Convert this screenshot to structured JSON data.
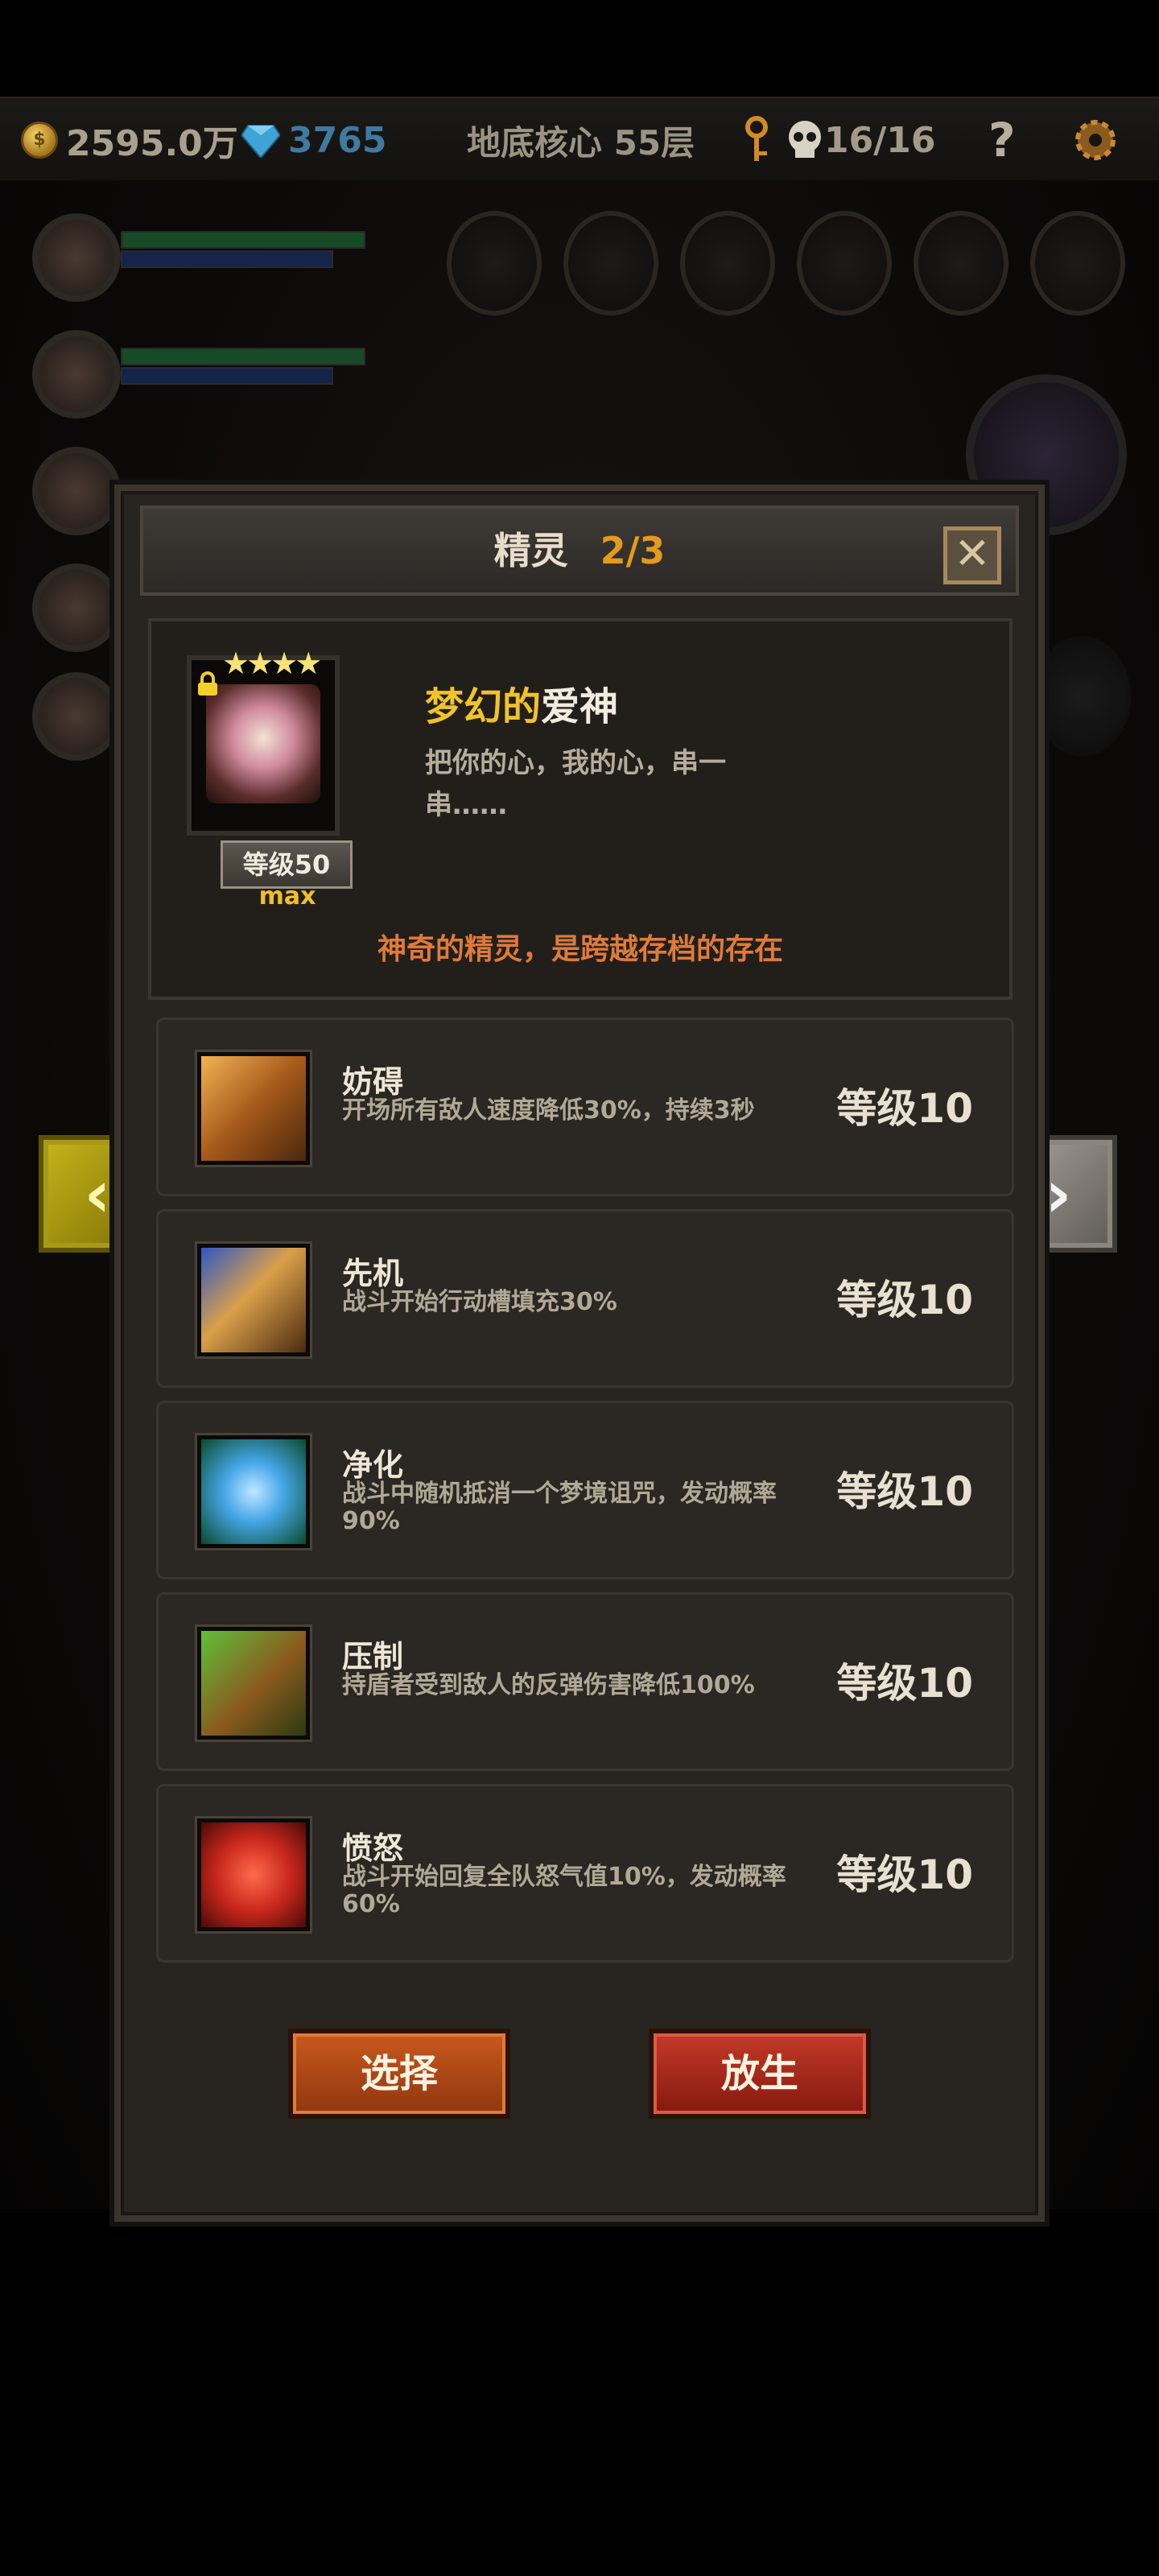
{
  "hud": {
    "gold": "2595.0万",
    "gems": "3765",
    "floor": "地底核心 55层",
    "skull_count": "16/16",
    "help": "?"
  },
  "dialog": {
    "title": "精灵",
    "page_count": "2/3",
    "close": "✕"
  },
  "spirit": {
    "stars": "★★★★",
    "name_part1": "梦幻的",
    "name_part2": "爱神",
    "description": "把你的心，我的心，串一串……",
    "level": "等级50",
    "max_label": "max",
    "tagline": "神奇的精灵，是跨越存档的存在"
  },
  "skills": [
    {
      "name": "妨碍",
      "desc": "开场所有敌人速度降低30%，持续3秒",
      "level": "等级10",
      "icon": "chain-boot-icon"
    },
    {
      "name": "先机",
      "desc": "战斗开始行动槽填充30%",
      "level": "等级10",
      "icon": "leopard-icon"
    },
    {
      "name": "净化",
      "desc": "战斗中随机抵消一个梦境诅咒，发动概率90%",
      "level": "等级10",
      "icon": "blue-flower-icon"
    },
    {
      "name": "压制",
      "desc": "持盾者受到敌人的反弹伤害降低100%",
      "level": "等级10",
      "icon": "beast-claw-icon"
    },
    {
      "name": "愤怒",
      "desc": "战斗开始回复全队怒气值10%，发动概率60%",
      "level": "等级10",
      "icon": "red-beast-icon"
    }
  ],
  "buttons": {
    "select": "选择",
    "release": "放生"
  },
  "arrows": {
    "left": "‹",
    "right": "›"
  },
  "colors": {
    "accent_gold": "#f0c32a",
    "count_orange": "#e39a1e",
    "tagline_orange": "#e07a3c",
    "select_button": "#c9591d",
    "release_button": "#c43a28"
  }
}
